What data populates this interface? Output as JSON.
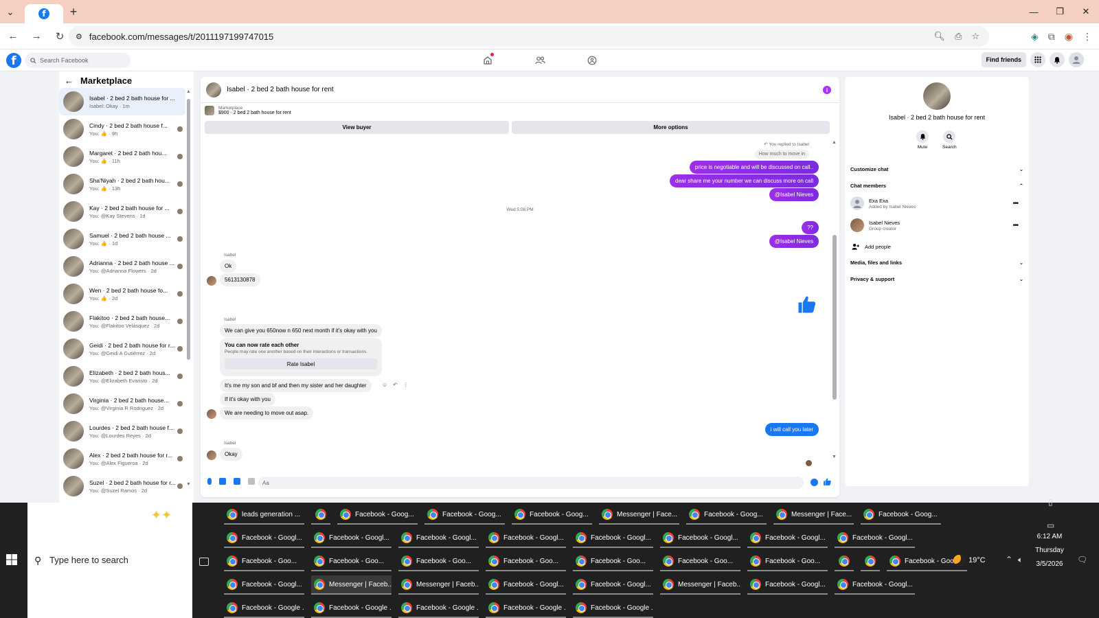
{
  "browser": {
    "url": "facebook.com/messages/t/2011197199747015"
  },
  "facebook": {
    "search_placeholder": "Search Facebook",
    "find_friends": "Find friends"
  },
  "sidebar": {
    "title": "Marketplace",
    "conversations": [
      {
        "name": "Isabel · 2 bed 2 bath house for ...",
        "sub": "Isabel: Okay · 1m",
        "active": true
      },
      {
        "name": "Cindy · 2 bed 2 bath house f...",
        "sub": "You: 👍 · 9h"
      },
      {
        "name": "Margaret · 2 bed 2 bath hou...",
        "sub": "You: 👍 · 11h"
      },
      {
        "name": "Sha'Niyah · 2 bed 2 bath hou...",
        "sub": "You: 👍 · 13h"
      },
      {
        "name": "Kay · 2 bed 2 bath house for ...",
        "sub": "You: @Kay Stevens · 1d"
      },
      {
        "name": "Samuel · 2 bed 2 bath house ...",
        "sub": "You: 👍 · 1d"
      },
      {
        "name": "Adrianna · 2 bed 2 bath house ...",
        "sub": "You: @Adrianna Flowers · 2d"
      },
      {
        "name": "Wen · 2 bed 2 bath house fo...",
        "sub": "You: 👍 · 2d"
      },
      {
        "name": "Flakitoo · 2 bed 2 bath house...",
        "sub": "You: @Flakitoo Velásquez · 2d"
      },
      {
        "name": "Geidi · 2 bed 2 bath house for r...",
        "sub": "You: @Geidi A Gutiérrez · 2d"
      },
      {
        "name": "Elizabeth · 2 bed 2 bath hous...",
        "sub": "You: @Elizabeth Evaristo · 2d"
      },
      {
        "name": "Virginia · 2 bed 2 bath house...",
        "sub": "You: @Virginia R Rodriguez · 2d"
      },
      {
        "name": "Lourdes · 2 bed 2 bath house f...",
        "sub": "You: @Lourdes Reyes · 2d"
      },
      {
        "name": "Alex · 2 bed 2 bath house for r...",
        "sub": "You: @Alex Figueroa · 2d"
      },
      {
        "name": "Suzel · 2 bed 2 bath house for r...",
        "sub": "You: @Suzel Ramos · 2d"
      }
    ]
  },
  "chat": {
    "title": "Isabel · 2 bed 2 bath house for rent",
    "marketplace_label": "Marketplace",
    "listing": "$900 · 2 bed 2 bath house for rent",
    "view_buyer": "View buyer",
    "more_options": "More options",
    "replied_label": "You replied to Isabel",
    "replied_quote": "How much to move in",
    "out1": "price is negotiable and will be discussed on call..",
    "out2": "dear share me your number we can discuss more on call",
    "out3": "@Isabel Nieves",
    "date_sep": "Wed 5:08 PM",
    "out4": "??",
    "out5": "@Isabel Nieves",
    "sender": "Isabel",
    "in1": "Ok",
    "in2": "5613130878",
    "in3": "We can give you 650now n 650 next month if it's okay with you",
    "rate_title": "You can now rate each other",
    "rate_sub": "People may rate one another based on their interactions or transactions.",
    "rate_btn": "Rate Isabel",
    "in4": "It's me my son and bf and then my sister and her daughter",
    "in5": "If it's okay with you",
    "in6": "We are needing to move out asap.",
    "out6": "i will call you later",
    "in7": "Okay",
    "composer_placeholder": "Aa"
  },
  "details": {
    "title": "Isabel · 2 bed 2 bath house for rent",
    "mute": "Mute",
    "search": "Search",
    "customize": "Customize chat",
    "members_header": "Chat members",
    "members": [
      {
        "name": "Exa Exa",
        "sub": "Added by Isabel Nieves"
      },
      {
        "name": "Isabel Nieves",
        "sub": "Group creator"
      }
    ],
    "add_people": "Add people",
    "media": "Media, files and links",
    "privacy": "Privacy & support"
  },
  "taskbar": {
    "search_placeholder": "Type here to search",
    "rows": [
      [
        "leads generation ...",
        "",
        "Facebook - Goog...",
        "Facebook - Goog...",
        "Facebook - Goog...",
        "Messenger | Face...",
        "Facebook - Goog...",
        "Messenger | Face...",
        "Facebook - Goog..."
      ],
      [
        "Facebook - Googl...",
        "Facebook - Googl...",
        "Facebook - Googl...",
        "Facebook - Googl...",
        "Facebook - Googl...",
        "Facebook - Googl...",
        "Facebook - Googl...",
        "Facebook - Googl..."
      ],
      [
        "Facebook - Goo...",
        "Facebook - Goo...",
        "Facebook - Goo...",
        "Facebook - Goo...",
        "Facebook - Goo...",
        "Facebook - Goo...",
        "Facebook - Goo...",
        "",
        "",
        "Facebook - Goo..."
      ],
      [
        "Facebook - Googl...",
        "Messenger | Faceb...",
        "Messenger | Faceb...",
        "Facebook - Googl...",
        "Facebook - Googl...",
        "Messenger | Faceb...",
        "Facebook - Googl...",
        "Facebook - Googl..."
      ],
      [
        "Facebook - Google ...",
        "Facebook - Google ...",
        "Facebook - Google ...",
        "Facebook - Google ...",
        "Facebook - Google ..."
      ]
    ],
    "weather": "19°C",
    "time": "6:12 AM",
    "day": "Thursday",
    "date": "3/5/2026"
  }
}
